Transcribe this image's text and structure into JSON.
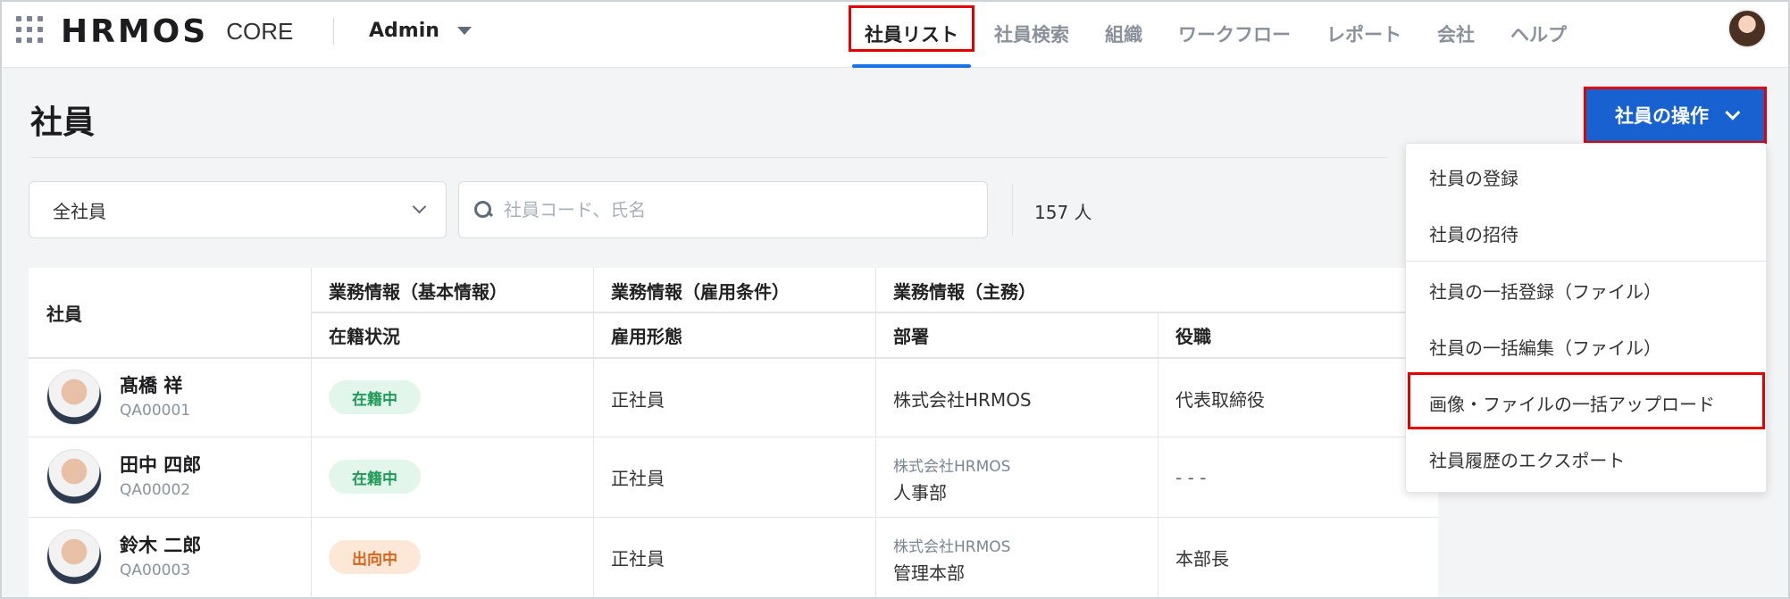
{
  "header": {
    "logo_main": "HRMOS",
    "logo_sub": "CORE",
    "role": "Admin",
    "nav": [
      "社員リスト",
      "社員検索",
      "組織",
      "ワークフロー",
      "レポート",
      "会社",
      "ヘルプ"
    ],
    "active_nav": "社員リスト"
  },
  "page": {
    "title": "社員",
    "ops_button": "社員の操作"
  },
  "filters": {
    "scope_value": "全社員",
    "search_placeholder": "社員コード、氏名",
    "count": "157 人"
  },
  "table": {
    "group_headers": {
      "employee": "社員",
      "basic": "業務情報（基本情報）",
      "employment": "業務情報（雇用条件）",
      "main": "業務情報（主務）"
    },
    "sub_headers": {
      "status": "在籍状況",
      "type": "雇用形態",
      "dept": "部署",
      "position": "役職"
    },
    "rows": [
      {
        "name": "髙橋 祥",
        "code": "QA00001",
        "status": "在籍中",
        "status_color": "#1f9a58",
        "type": "正社員",
        "dept_parent": "",
        "dept": "株式会社HRMOS",
        "position": "代表取締役"
      },
      {
        "name": "田中 四郎",
        "code": "QA00002",
        "status": "在籍中",
        "status_color": "#1f9a58",
        "type": "正社員",
        "dept_parent": "株式会社HRMOS",
        "dept": "人事部",
        "position": "- - -"
      },
      {
        "name": "鈴木 二郎",
        "code": "QA00003",
        "status": "出向中",
        "status_color": "#d6651c",
        "type": "正社員",
        "dept_parent": "株式会社HRMOS",
        "dept": "管理本部",
        "position": "本部長"
      }
    ]
  },
  "ops_menu": {
    "items": [
      "社員の登録",
      "社員の招待",
      "社員の一括登録（ファイル）",
      "社員の一括編集（ファイル）",
      "画像・ファイルの一括アップロード",
      "社員履歴のエクスポート"
    ],
    "highlighted": "画像・ファイルの一括アップロード"
  },
  "colors": {
    "primary": "#1762d0",
    "highlight_box": "#e30000",
    "nav_underline": "#1a73e8"
  }
}
